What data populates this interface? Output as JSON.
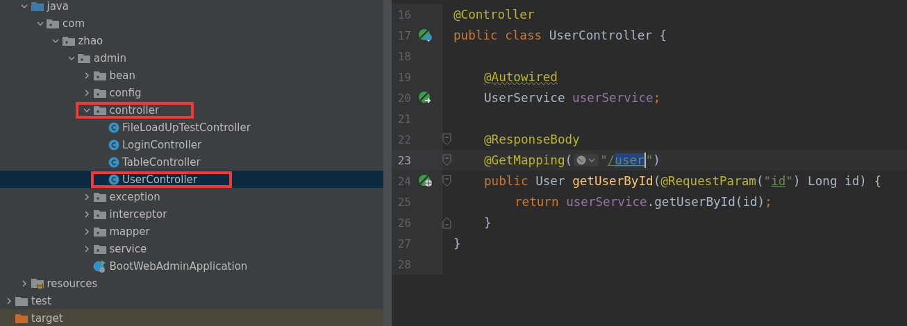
{
  "tree": {
    "inner_items": [
      {
        "label": "java",
        "kind": "source-root",
        "expanded": true,
        "selected": false,
        "annotated": false,
        "children": [
          {
            "label": "com",
            "kind": "package",
            "expanded": true,
            "selected": false,
            "annotated": false,
            "children": [
              {
                "label": "zhao",
                "kind": "package",
                "expanded": true,
                "selected": false,
                "annotated": false,
                "children": [
                  {
                    "label": "admin",
                    "kind": "package",
                    "expanded": true,
                    "selected": false,
                    "annotated": false,
                    "children": [
                      {
                        "label": "bean",
                        "kind": "package",
                        "expanded": false,
                        "selected": false,
                        "annotated": false
                      },
                      {
                        "label": "config",
                        "kind": "package",
                        "expanded": false,
                        "selected": false,
                        "annotated": false
                      },
                      {
                        "label": "controller",
                        "kind": "package",
                        "expanded": true,
                        "selected": false,
                        "annotated": true,
                        "children": [
                          {
                            "label": "FileLoadUpTestController",
                            "kind": "class",
                            "selected": false,
                            "annotated": false
                          },
                          {
                            "label": "LoginController",
                            "kind": "class",
                            "selected": false,
                            "annotated": false
                          },
                          {
                            "label": "TableController",
                            "kind": "class",
                            "selected": false,
                            "annotated": false
                          },
                          {
                            "label": "UserController",
                            "kind": "class",
                            "selected": true,
                            "annotated": true
                          }
                        ]
                      },
                      {
                        "label": "exception",
                        "kind": "package",
                        "expanded": false,
                        "selected": false,
                        "annotated": false
                      },
                      {
                        "label": "interceptor",
                        "kind": "package",
                        "expanded": false,
                        "selected": false,
                        "annotated": false
                      },
                      {
                        "label": "mapper",
                        "kind": "package",
                        "expanded": false,
                        "selected": false,
                        "annotated": false
                      },
                      {
                        "label": "service",
                        "kind": "package",
                        "expanded": false,
                        "selected": false,
                        "annotated": false
                      },
                      {
                        "label": "BootWebAdminApplication",
                        "kind": "spring-app",
                        "selected": false,
                        "annotated": false
                      }
                    ]
                  }
                ]
              }
            ]
          }
        ]
      },
      {
        "label": "resources",
        "kind": "resources",
        "expanded": false,
        "selected": false,
        "annotated": false
      }
    ],
    "outer_items": [
      {
        "label": "test",
        "kind": "folder",
        "expanded": false,
        "selected": false,
        "annotated": false
      },
      {
        "label": "target",
        "kind": "excluded",
        "selected": false,
        "annotated": false
      }
    ]
  },
  "editor": {
    "lines": [
      {
        "number": "16",
        "current": false,
        "tokens": [
          {
            "kind": "annotation",
            "text": "@Controller"
          }
        ]
      },
      {
        "number": "17",
        "current": false,
        "gutter": {
          "kind": "bean"
        },
        "tokens": [
          {
            "kind": "keyword",
            "text": "public class "
          },
          {
            "kind": "plain",
            "text": "UserController {"
          }
        ]
      },
      {
        "number": "18",
        "current": false
      },
      {
        "number": "19",
        "current": false,
        "indent": {
          "kind": "class"
        },
        "tokens": [
          {
            "kind": "annotation-warn",
            "text": "@Autowired"
          }
        ]
      },
      {
        "number": "20",
        "current": false,
        "indent": {
          "kind": "class"
        },
        "gutter": {
          "kind": "inject"
        },
        "tokens": [
          {
            "kind": "plain",
            "text": "UserService "
          },
          {
            "kind": "field",
            "text": "userService"
          },
          {
            "kind": "keyword",
            "text": ";"
          }
        ]
      },
      {
        "number": "21",
        "current": false
      },
      {
        "number": "22",
        "current": false,
        "indent": {
          "kind": "class"
        },
        "fold": {
          "kind": "start"
        },
        "tokens": [
          {
            "kind": "annotation",
            "text": "@ResponseBody"
          }
        ]
      },
      {
        "number": "23",
        "current": true,
        "indent": {
          "kind": "class"
        },
        "fold": {
          "kind": "start"
        },
        "tokens": [
          {
            "kind": "annotation",
            "text": "@GetMapping"
          },
          {
            "kind": "plain",
            "text": "("
          },
          {
            "kind": "inlay"
          },
          {
            "kind": "string",
            "text": "\""
          },
          {
            "kind": "link",
            "text": "/"
          },
          {
            "kind": "link-selected",
            "text": "user"
          },
          {
            "kind": "caret"
          },
          {
            "kind": "string",
            "text": "\""
          },
          {
            "kind": "plain",
            "text": ")"
          }
        ]
      },
      {
        "number": "24",
        "current": false,
        "indent": {
          "kind": "class"
        },
        "gutter": {
          "kind": "web"
        },
        "fold": {
          "kind": "start"
        },
        "tokens": [
          {
            "kind": "keyword",
            "text": "public "
          },
          {
            "kind": "plain",
            "text": "User "
          },
          {
            "kind": "method",
            "text": "getUserById"
          },
          {
            "kind": "plain",
            "text": "("
          },
          {
            "kind": "annotation",
            "text": "@RequestParam"
          },
          {
            "kind": "plain",
            "text": "("
          },
          {
            "kind": "string",
            "text": "\""
          },
          {
            "kind": "link",
            "text": "id"
          },
          {
            "kind": "string",
            "text": "\""
          },
          {
            "kind": "plain",
            "text": ") Long id) {"
          }
        ]
      },
      {
        "number": "25",
        "current": false,
        "indent": {
          "kind": "method"
        },
        "tokens": [
          {
            "kind": "keyword",
            "text": "return "
          },
          {
            "kind": "field",
            "text": "userService"
          },
          {
            "kind": "plain",
            "text": ".getUserById(id)"
          },
          {
            "kind": "keyword",
            "text": ";"
          }
        ]
      },
      {
        "number": "26",
        "current": false,
        "indent": {
          "kind": "class"
        },
        "fold": {
          "kind": "end"
        },
        "tokens": [
          {
            "kind": "plain",
            "text": "}"
          }
        ]
      },
      {
        "number": "27",
        "current": false,
        "tokens": [
          {
            "kind": "plain",
            "text": "}"
          }
        ]
      },
      {
        "number": "28",
        "current": false
      }
    ]
  }
}
